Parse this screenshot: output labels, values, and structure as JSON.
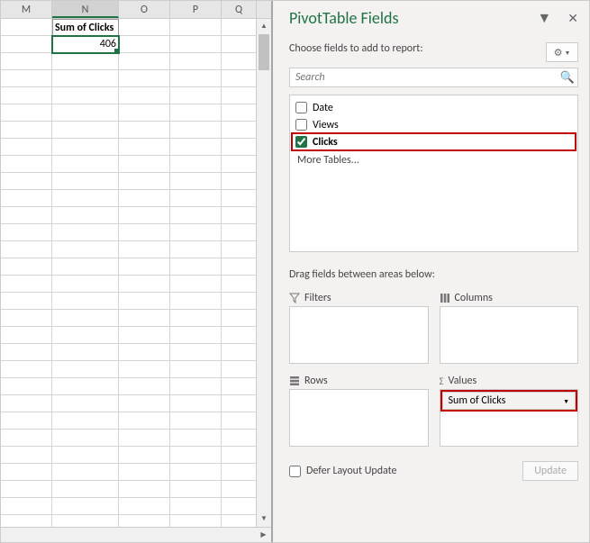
{
  "grid": {
    "columns": [
      "M",
      "N",
      "O",
      "P",
      "Q"
    ],
    "selected_col": "N",
    "header_cell": "Sum of Clicks",
    "value_cell": "406"
  },
  "pane": {
    "title": "PivotTable Fields",
    "choose_label": "Choose fields to add to report:",
    "search_placeholder": "Search",
    "fields": {
      "date": {
        "label": "Date",
        "checked": false
      },
      "views": {
        "label": "Views",
        "checked": false
      },
      "clicks": {
        "label": "Clicks",
        "checked": true
      }
    },
    "more_tables": "More Tables...",
    "drag_label": "Drag fields between areas below:",
    "areas": {
      "filters": "Filters",
      "columns": "Columns",
      "rows": "Rows",
      "values": "Values"
    },
    "value_item": "Sum of Clicks",
    "defer_label": "Defer Layout Update",
    "update_btn": "Update"
  }
}
